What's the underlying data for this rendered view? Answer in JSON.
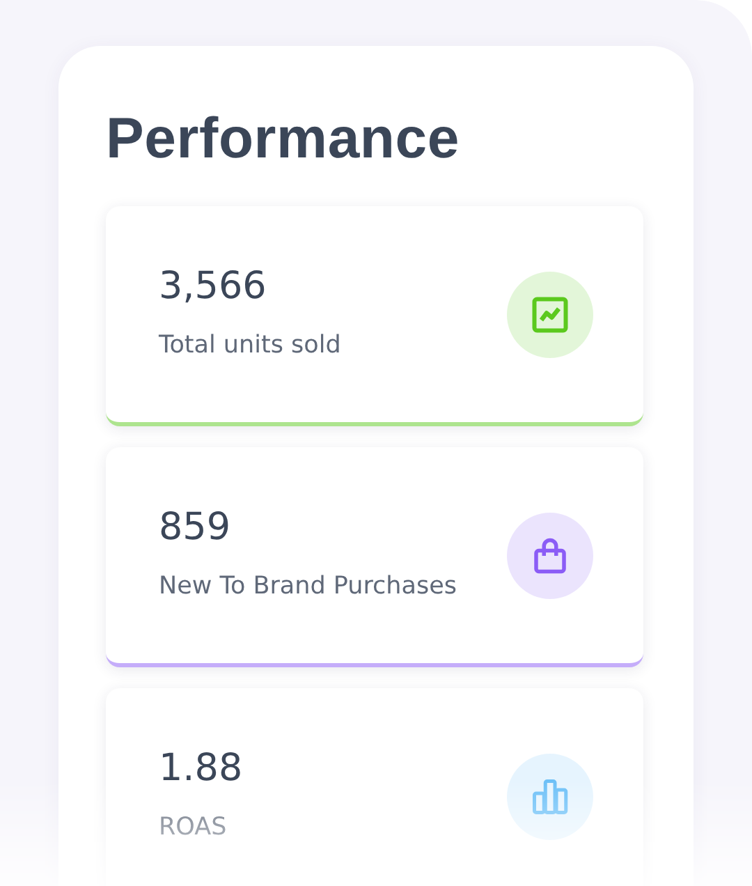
{
  "title": "Performance",
  "stats": [
    {
      "value": "3,566",
      "label": "Total units sold",
      "kind": "trend",
      "color": "#5bc91e"
    },
    {
      "value": "859",
      "label": "New To Brand Purchases",
      "kind": "bag",
      "color": "#8b5cf6"
    },
    {
      "value": "1.88",
      "label": "ROAS",
      "kind": "chart",
      "color": "#6cc0f7"
    }
  ]
}
